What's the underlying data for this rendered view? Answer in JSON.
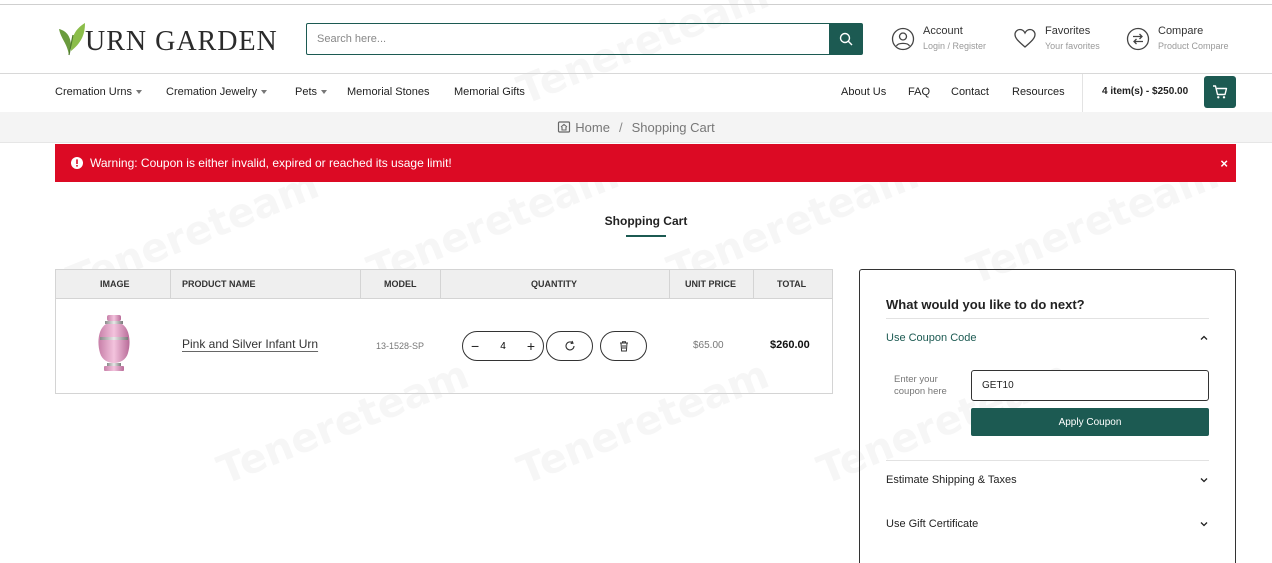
{
  "header": {
    "logo_text": "URN GARDEN",
    "search_placeholder": "Search here...",
    "account": {
      "title": "Account",
      "sub": "Login / Register"
    },
    "favorites": {
      "title": "Favorites",
      "sub": "Your favorites"
    },
    "compare": {
      "title": "Compare",
      "sub": "Product Compare"
    }
  },
  "nav": {
    "left": [
      {
        "label": "Cremation Urns",
        "dropdown": true
      },
      {
        "label": "Cremation Jewelry",
        "dropdown": true
      },
      {
        "label": "Pets",
        "dropdown": true
      },
      {
        "label": "Memorial Stones",
        "dropdown": false
      },
      {
        "label": "Memorial Gifts",
        "dropdown": false
      }
    ],
    "right": [
      "About Us",
      "FAQ",
      "Contact",
      "Resources"
    ],
    "cart_total": "4 item(s) - $250.00"
  },
  "breadcrumb": {
    "home": "Home",
    "current": "Shopping Cart"
  },
  "alert": {
    "message": "Warning: Coupon is either invalid, expired or reached its usage limit!",
    "close": "×"
  },
  "page_title": "Shopping Cart",
  "table": {
    "headers": [
      "Image",
      "Product Name",
      "Model",
      "Quantity",
      "Unit Price",
      "Total"
    ],
    "row": {
      "product_name": "Pink and Silver Infant Urn",
      "model": "13-1528-SP",
      "quantity": "4",
      "unit_price": "$65.00",
      "total": "$260.00"
    }
  },
  "panel": {
    "title": "What would you like to do next?",
    "coupon_head": "Use Coupon Code",
    "coupon_label": "Enter your coupon here",
    "coupon_value": "GET10",
    "apply_label": "Apply Coupon",
    "shipping_head": "Estimate Shipping & Taxes",
    "gift_head": "Use Gift Certificate"
  },
  "watermark": "Tenereteam",
  "colors": {
    "brand": "#1c5a52",
    "alert": "#dc0a24"
  }
}
